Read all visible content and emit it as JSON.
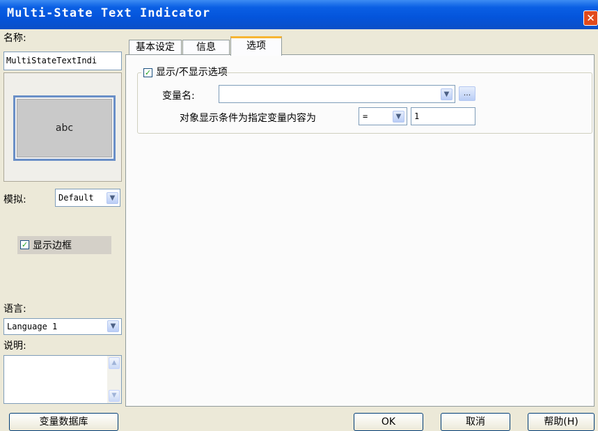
{
  "window": {
    "title": "Multi-State Text Indicator",
    "close_icon": "close-icon"
  },
  "left": {
    "name_label": "名称:",
    "name_value": "MultiStateTextIndi",
    "preview_text": "abc",
    "simulate_label": "模拟:",
    "simulate_value": "Default",
    "show_border_label": "显示边框",
    "language_label": "语言:",
    "language_value": "Language 1",
    "description_label": "说明:",
    "description_value": ""
  },
  "tabs": [
    {
      "label": "基本设定"
    },
    {
      "label": "信息"
    },
    {
      "label": "选项"
    }
  ],
  "options": {
    "group_label": "显示/不显示选项",
    "variable_label": "变量名:",
    "variable_value": "",
    "browse_label": "...",
    "condition_label": "对象显示条件为指定变量内容为",
    "operator_value": "=",
    "condition_value": "1"
  },
  "footer": {
    "variable_db_button": "变量数据库",
    "ok_button": "OK",
    "cancel_button": "取消",
    "help_button": "帮助(H)"
  },
  "colors": {
    "titlebar": "#0454db",
    "dialog_bg": "#ece9d8",
    "checkmark": "#21a121",
    "active_tab_accent": "#f7b532"
  }
}
